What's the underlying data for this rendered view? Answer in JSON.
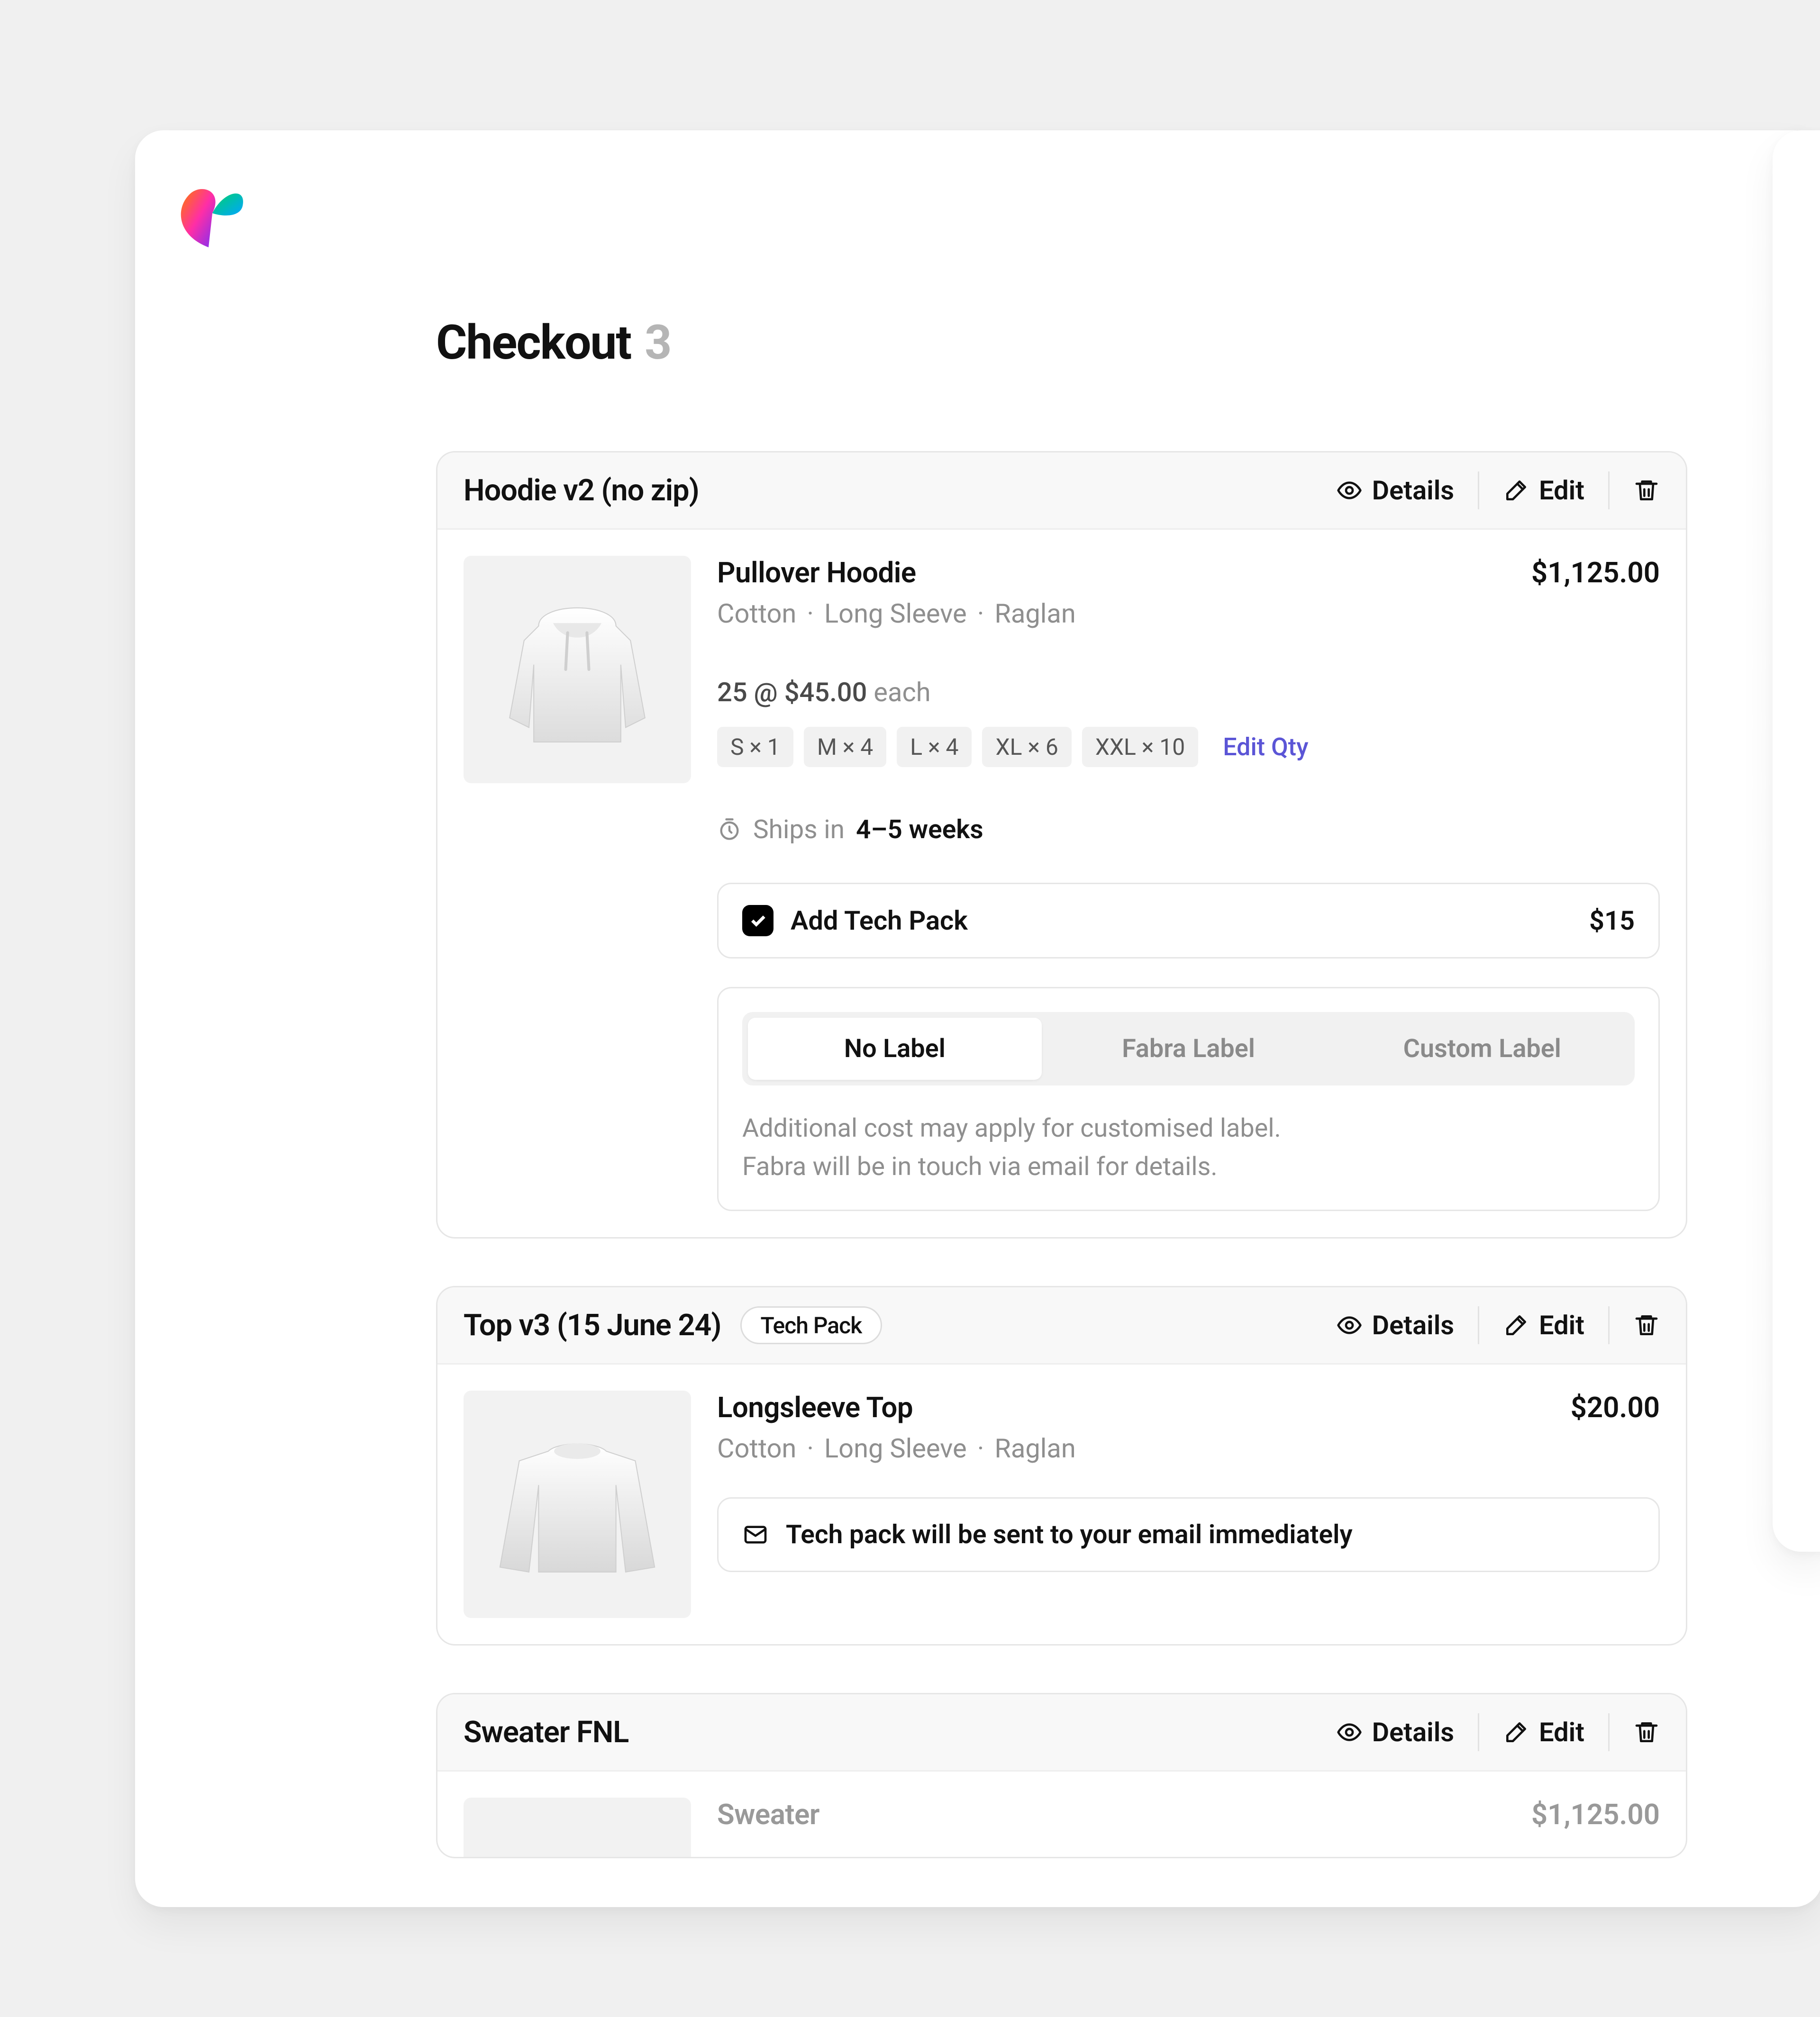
{
  "page": {
    "title": "Checkout",
    "count": "3"
  },
  "actions": {
    "details": "Details",
    "edit": "Edit",
    "editQty": "Edit Qty"
  },
  "cards": [
    {
      "title": "Hoodie v2 (no zip)",
      "chip": "",
      "product": "Pullover Hoodie",
      "attrs": [
        "Cotton",
        "Long Sleeve",
        "Raglan"
      ],
      "price": "$1,125.00",
      "qty": {
        "count": "25",
        "unit": "$45.00",
        "suffix": "each"
      },
      "sizes": [
        "S × 1",
        "M × 4",
        "L × 4",
        "XL × 6",
        "XXL × 10"
      ],
      "ships_prefix": "Ships in",
      "ships_value": "4–5 weeks",
      "techpack": {
        "label": "Add Tech Pack",
        "price": "$15"
      },
      "labels": {
        "opts": [
          "No Label",
          "Fabra Label",
          "Custom Label"
        ],
        "active": 0
      },
      "note": "Additional cost may apply for customised label.\nFabra will be in touch via email for details."
    },
    {
      "title": "Top v3 (15 June 24)",
      "chip": "Tech Pack",
      "product": "Longsleeve Top",
      "attrs": [
        "Cotton",
        "Long Sleeve",
        "Raglan"
      ],
      "price": "$20.00",
      "mailmsg": "Tech pack will be sent to your email immediately"
    },
    {
      "title": "Sweater FNL",
      "product": "Sweater",
      "price": "$1,125.00"
    }
  ]
}
